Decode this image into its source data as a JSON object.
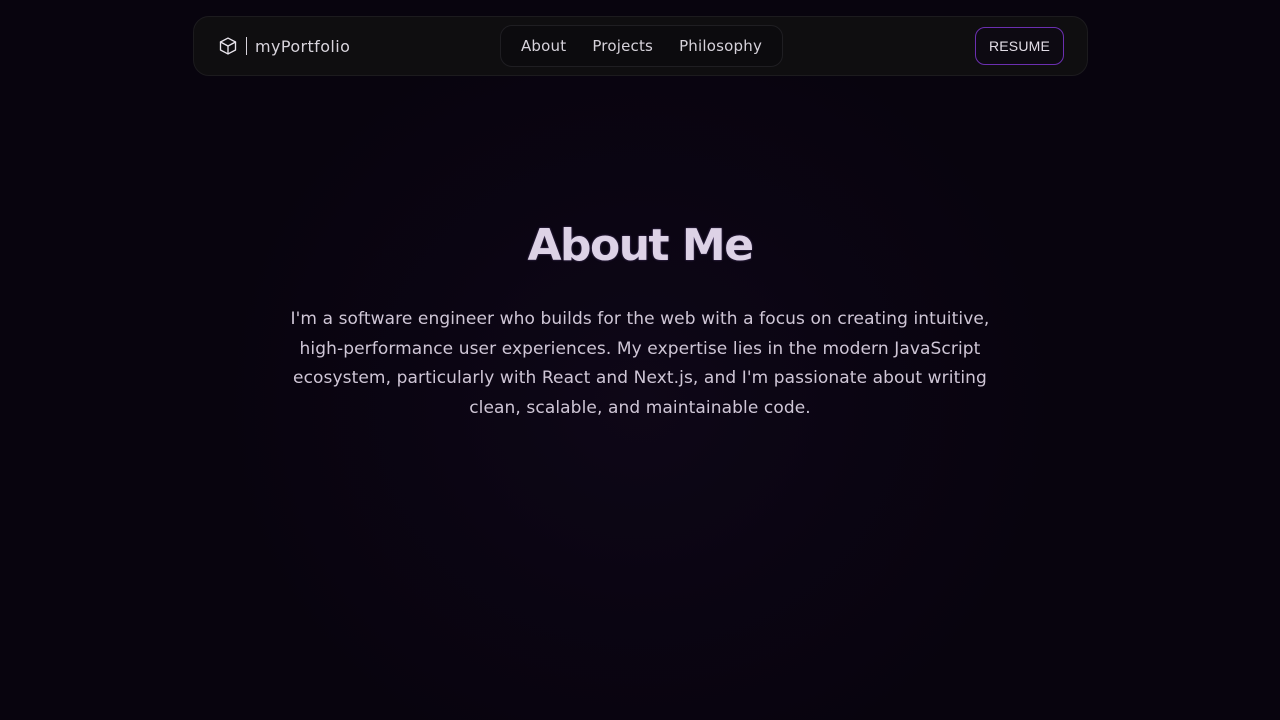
{
  "nav": {
    "brand": "myPortfolio",
    "brand_icon": "cube-icon",
    "links": [
      {
        "label": "About"
      },
      {
        "label": "Projects"
      },
      {
        "label": "Philosophy"
      }
    ],
    "resume_label": "RESUME",
    "accent_color": "#6b2fb0"
  },
  "about": {
    "title": "About Me",
    "text": "I'm a software engineer who builds for the web with a focus on creating intuitive, high-performance user experiences. My expertise lies in the modern JavaScript ecosystem, particularly with React and Next.js, and I'm passionate about writing clean, scalable, and maintainable code."
  }
}
